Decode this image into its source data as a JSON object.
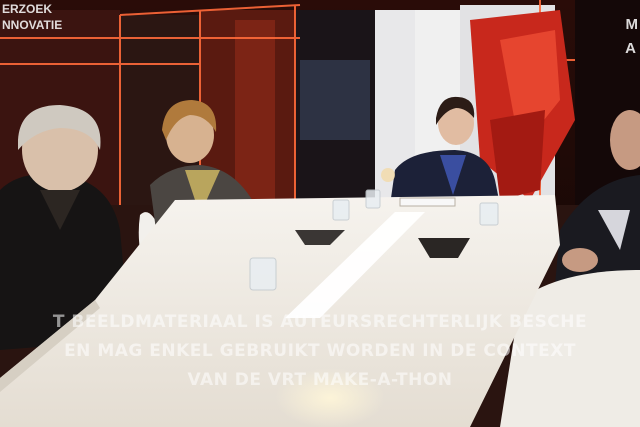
{
  "scene": {
    "description_tag": "tv-studio-table-discussion"
  },
  "corner_tags": {
    "left_line_1": "ERZOEK",
    "left_line_2": "NNOVATIE",
    "right_line_1": "M",
    "right_line_2": "A"
  },
  "watermark": {
    "line_1": "T BEELDMATERIAAL IS AUTEURSRECHTERLIJK BESCHE",
    "line_2": "EN MAG ENKEL GEBRUIKT WORDEN IN DE CONTEXT",
    "line_3": "VAN DE VRT    MAKE-A-THON"
  },
  "colors": {
    "studio_red": "#c8281c",
    "table_white": "#f3efe9",
    "neon_orange": "#ff6a3a"
  }
}
